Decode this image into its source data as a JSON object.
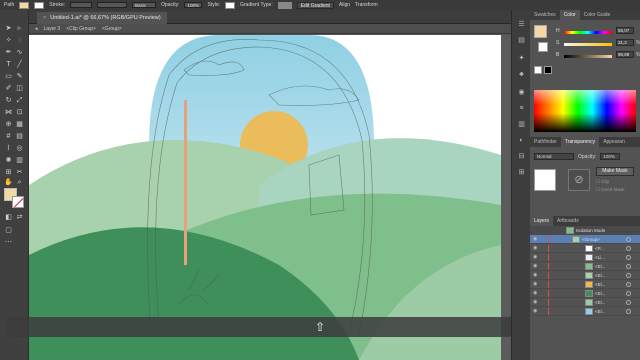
{
  "control_bar": {
    "object_type": "Path",
    "stroke_label": "Stroke:",
    "style_preset": "Basic",
    "opacity_label": "Opacity:",
    "opacity_value": "100%",
    "style_label": "Style:",
    "gradient_label": "Gradient Type:",
    "edit_gradient": "Edit Gradient",
    "align_label": "Align",
    "transform_label": "Transform"
  },
  "document_tab": {
    "title": "Untitled-1.ai* @ 66,67% (RGB/GPU Preview)",
    "close": "×"
  },
  "breadcrumb": [
    "Layer 3",
    "<Clip Group>",
    "<Group>"
  ],
  "colors": {
    "fill": "#f3d9a4",
    "sky_top": "#8fd0e3",
    "sun": "#f2b84b",
    "hill_light": "#a8d1ae",
    "hill_mid": "#7fbf8b",
    "hill_dark": "#3f8f5b",
    "accent_red": "#e24a4a"
  },
  "swatch_panel": {
    "tabs": [
      "Swatches",
      "Color",
      "Color Guide"
    ],
    "active_tab": "Color",
    "sliders": [
      {
        "label": "H",
        "value": "55,07",
        "unit": ""
      },
      {
        "label": "S",
        "value": "31,2",
        "unit": "%"
      },
      {
        "label": "B",
        "value": "95,69",
        "unit": "%"
      }
    ]
  },
  "transparency_panel": {
    "tabs": [
      "Pathfinder",
      "Transparency",
      "Appearan"
    ],
    "active_tab": "Transparency",
    "blend_mode": "Normal",
    "opacity_label": "Opacity:",
    "opacity_value": "100%",
    "make_mask": "Make Mask",
    "clip_label": "Clip",
    "invert_label": "Invert Mask"
  },
  "layers_panel": {
    "tabs": [
      "Layers",
      "Artboards"
    ],
    "active_tab": "Layers",
    "rows": [
      {
        "name": "Isolation Mode",
        "kind": "iso"
      },
      {
        "name": "<Group>",
        "kind": "sel"
      },
      {
        "name": "<P...",
        "kind": "normal"
      },
      {
        "name": "<Li...",
        "kind": "normal"
      },
      {
        "name": "<El...",
        "kind": "normal"
      },
      {
        "name": "<El...",
        "kind": "normal"
      },
      {
        "name": "<El...",
        "kind": "normal"
      },
      {
        "name": "<El...",
        "kind": "normal"
      },
      {
        "name": "<El...",
        "kind": "normal"
      },
      {
        "name": "<El...",
        "kind": "normal"
      }
    ]
  },
  "video_overlay": {
    "icon": "up-arrow-icon"
  }
}
